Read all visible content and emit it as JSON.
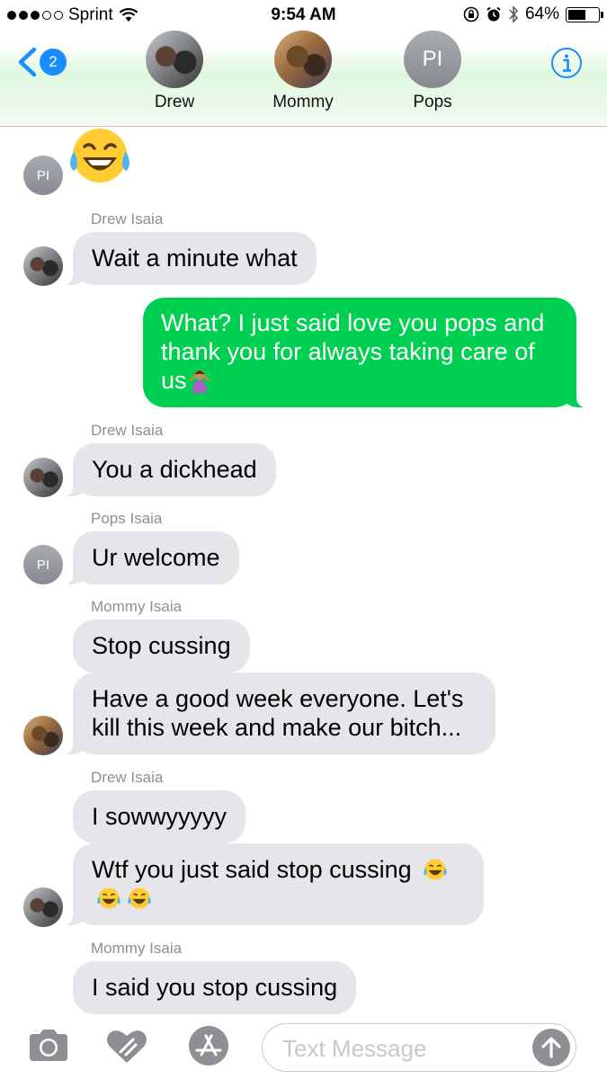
{
  "status_bar": {
    "carrier": "Sprint",
    "time": "9:54 AM",
    "battery": "64%",
    "battery_level": 0.64,
    "signal_bars_filled": 3,
    "signal_bars_total": 5,
    "icons": [
      "wifi-icon",
      "rotation-lock-icon",
      "alarm-icon",
      "bluetooth-icon",
      "battery-icon"
    ]
  },
  "header": {
    "back_badge": "2",
    "info_icon": "info-icon",
    "contacts": [
      {
        "name": "Drew",
        "avatar": "photo"
      },
      {
        "name": "Mommy",
        "avatar": "photo"
      },
      {
        "name": "Pops",
        "avatar": "initials",
        "initials": "PI"
      }
    ]
  },
  "conversation": {
    "avatar_initials": "PI",
    "messages": [
      {
        "type": "emoji",
        "emoji": "face-with-tears-of-joy",
        "from": "Pops"
      },
      {
        "type": "label",
        "text": "Drew Isaia"
      },
      {
        "type": "incoming",
        "text": "Wait a minute what",
        "from": "Drew"
      },
      {
        "type": "outgoing",
        "text": "What? I just said love you pops and thank you for always taking care of us",
        "emoji": "person-shrugging"
      },
      {
        "type": "label",
        "text": "Drew Isaia"
      },
      {
        "type": "incoming",
        "text": "You a dickhead",
        "from": "Drew"
      },
      {
        "type": "label",
        "text": "Pops Isaia"
      },
      {
        "type": "incoming",
        "text": "Ur welcome",
        "from": "Pops"
      },
      {
        "type": "label",
        "text": "Mommy Isaia"
      },
      {
        "type": "incoming",
        "text": "Stop cussing",
        "from": "Mommy"
      },
      {
        "type": "incoming",
        "text": "Have a good week everyone. Let's kill this week and make our bitch...",
        "from": "Mommy"
      },
      {
        "type": "label",
        "text": "Drew Isaia"
      },
      {
        "type": "incoming",
        "text": "I sowwyyyyy",
        "from": "Drew"
      },
      {
        "type": "incoming",
        "text": "Wtf you just said stop cussing",
        "emoji": "face-with-tears-of-joy x3",
        "from": "Drew"
      },
      {
        "type": "label",
        "text": "Mommy Isaia"
      },
      {
        "type": "incoming",
        "text": "I said you stop cussing",
        "from": "Mommy"
      }
    ]
  },
  "input_bar": {
    "placeholder": "Text Message",
    "value": "",
    "buttons": [
      "camera-icon",
      "digital-touch-icon",
      "app-store-icon",
      "send-icon"
    ]
  },
  "colors": {
    "outgoing_bubble": "#00d052",
    "incoming_bubble": "#e5e5ea",
    "accent": "#1a8cff",
    "sender_label": "#8e8e93"
  }
}
